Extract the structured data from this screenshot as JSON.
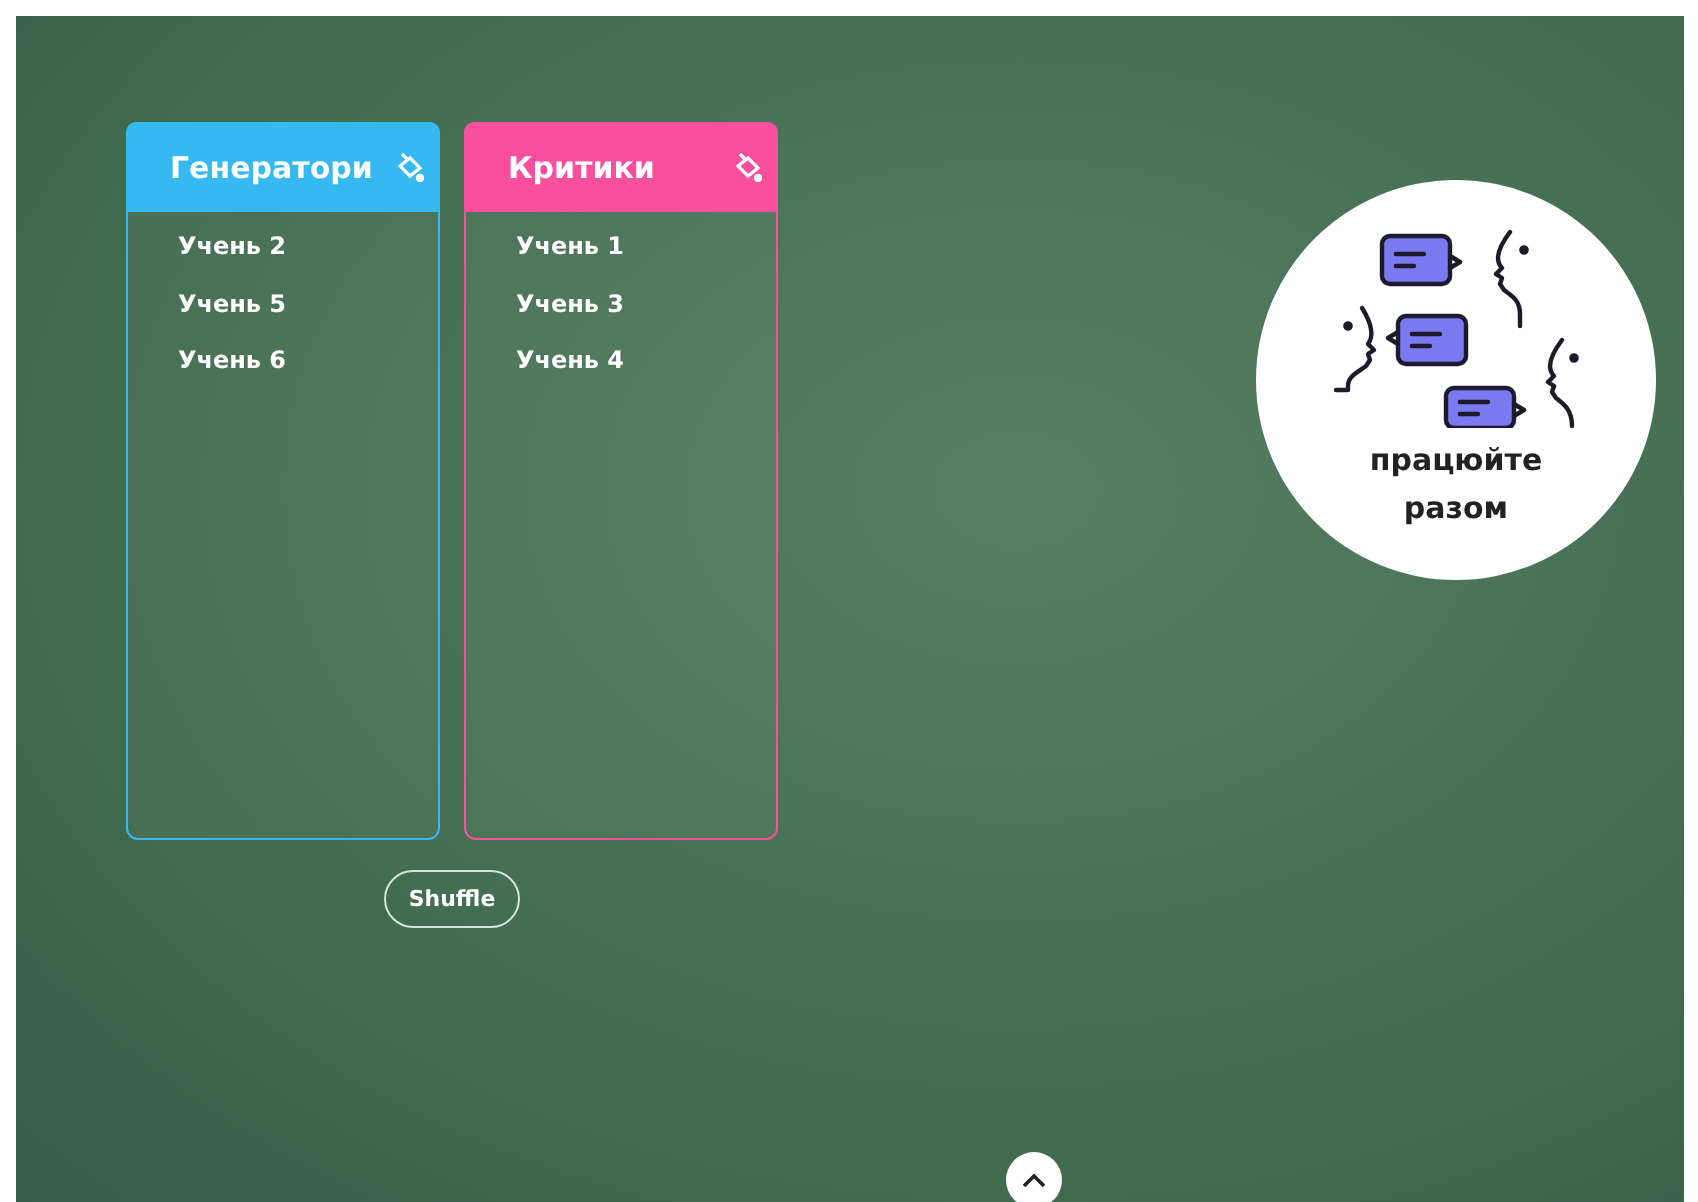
{
  "groups": [
    {
      "title": "Генератори",
      "color": "#36b8f1",
      "members": [
        "Учень 2",
        "Учень 5",
        "Учень 6"
      ]
    },
    {
      "title": "Критики",
      "color": "#f84f9f",
      "members": [
        "Учень 1",
        "Учень 3",
        "Учень 4"
      ]
    }
  ],
  "shuffle_button": "Shuffle",
  "badge": {
    "caption": "працюйте разом"
  }
}
